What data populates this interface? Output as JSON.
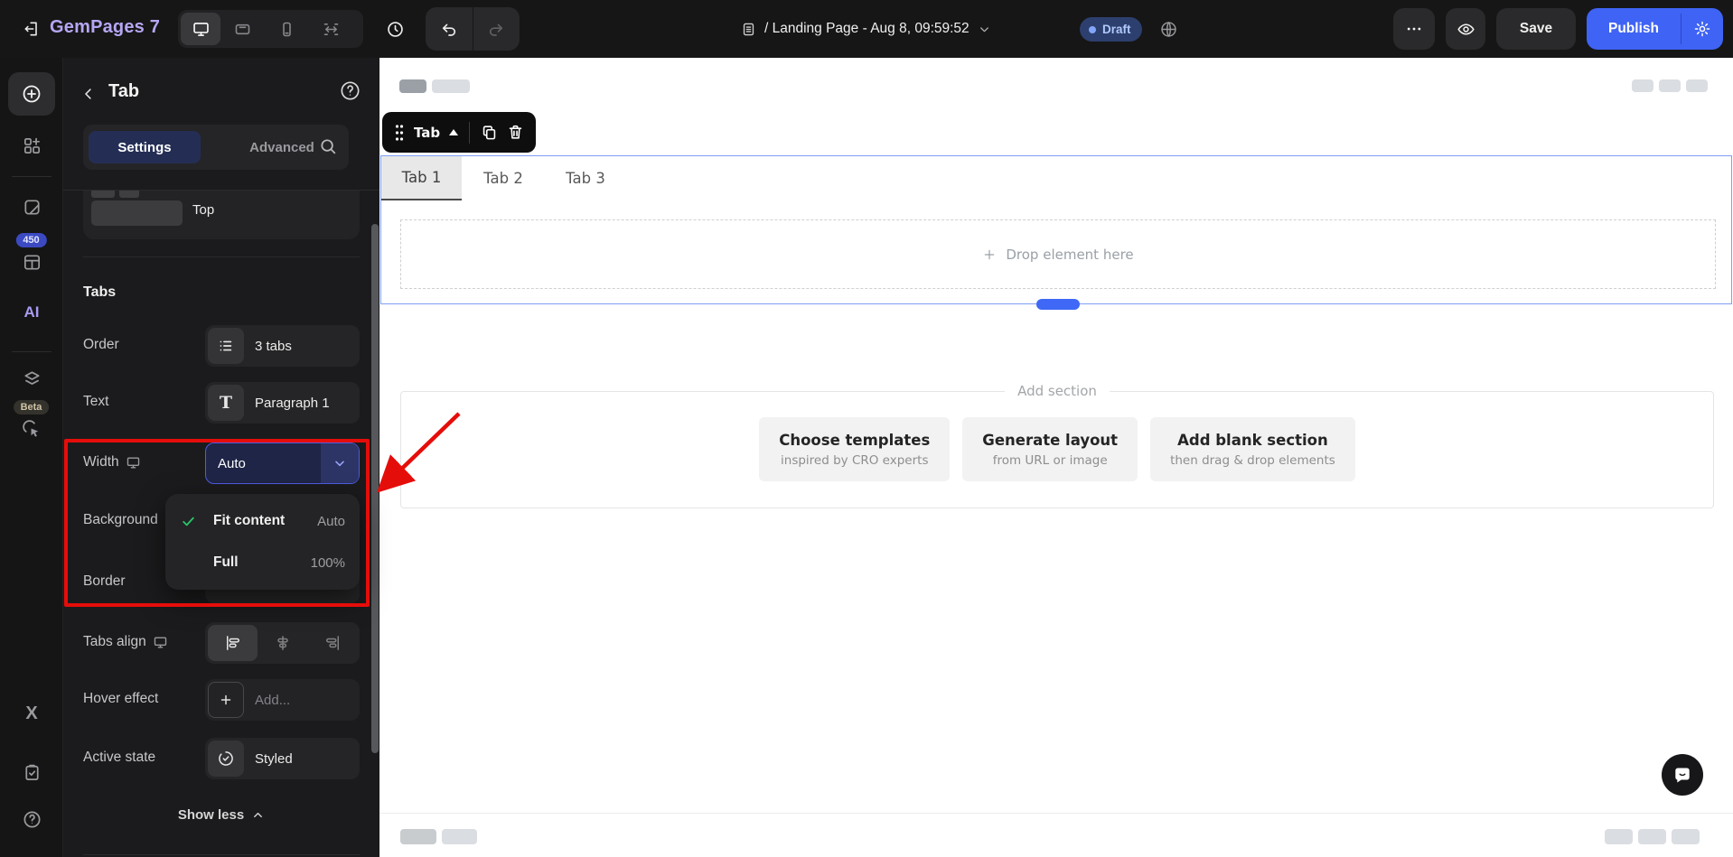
{
  "topbar": {
    "brand": "GemPages 7",
    "page_title": "/ Landing Page - Aug 8, 09:59:52",
    "status": "Draft",
    "save_label": "Save",
    "publish_label": "Publish"
  },
  "sidebar": {
    "templates_count": "450",
    "ai_label": "AI",
    "beta_label": "Beta",
    "x_label": "X"
  },
  "panel": {
    "title": "Tab",
    "tab_settings": "Settings",
    "tab_advanced": "Advanced",
    "position_value": "Top",
    "section_heading": "Tabs",
    "order_label": "Order",
    "order_value": "3 tabs",
    "text_label": "Text",
    "text_icon": "T",
    "text_value": "Paragraph 1",
    "width_label": "Width",
    "width_value": "Auto",
    "background_label": "Background",
    "border_label": "Border",
    "align_label": "Tabs align",
    "hover_label": "Hover effect",
    "hover_placeholder": "Add...",
    "active_label": "Active state",
    "active_value": "Styled",
    "show_less": "Show less",
    "width_dropdown": {
      "items": [
        {
          "label": "Fit content",
          "value": "Auto",
          "checked": true
        },
        {
          "label": "Full",
          "value": "100%",
          "checked": false
        }
      ]
    }
  },
  "canvas": {
    "toolbar_label": "Tab",
    "tabs": [
      "Tab 1",
      "Tab 2",
      "Tab 3"
    ],
    "drop_hint": "Drop element here",
    "add_section_title": "Add section",
    "cards": [
      {
        "title": "Choose templates",
        "subtitle": "inspired by CRO experts"
      },
      {
        "title": "Generate layout",
        "subtitle": "from URL or image"
      },
      {
        "title": "Add blank section",
        "subtitle": "then drag & drop elements"
      }
    ]
  },
  "colors": {
    "accent_blue": "#3f63f4",
    "draft_blue": "#b0c8fb",
    "annotation_red": "#e50d0a",
    "check_green": "#27c567",
    "selection_blue": "#7f9ff5",
    "brand_purple": "#b6a7f3",
    "active_tab_navy": "#242e55"
  }
}
